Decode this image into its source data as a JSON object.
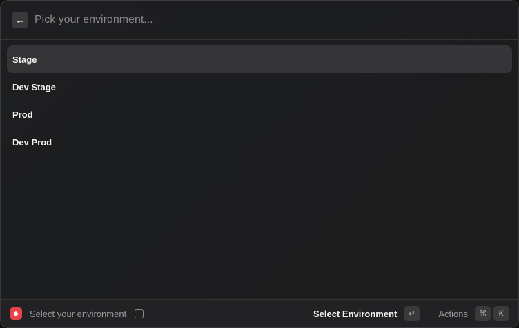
{
  "header": {
    "back_icon": "arrow-left-icon",
    "back_glyph": "←",
    "search_placeholder": "Pick your environment...",
    "search_value": ""
  },
  "list": {
    "items": [
      {
        "label": "Stage",
        "selected": true
      },
      {
        "label": "Dev Stage"
      },
      {
        "label": "Prod"
      },
      {
        "label": "Dev Prod"
      }
    ]
  },
  "footer": {
    "app_icon": "app-logo-icon",
    "app_icon_color": "#e8434b",
    "status": "Select your environment",
    "status_icon": "hard-drive-icon",
    "primary_action": "Select Environment",
    "primary_key": "↵",
    "actions_label": "Actions",
    "actions_keys": [
      "⌘",
      "K"
    ]
  }
}
